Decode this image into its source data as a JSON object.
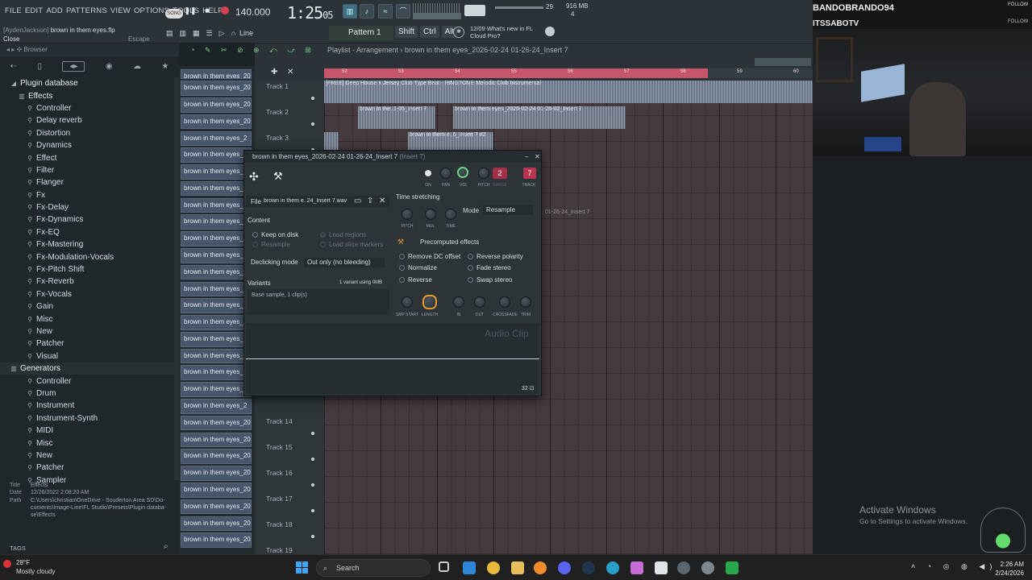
{
  "menu": [
    "FILE",
    "EDIT",
    "ADD",
    "PATTERNS",
    "VIEW",
    "OPTIONS",
    "TOOLS",
    "HELP"
  ],
  "hint": {
    "user": "[AydenJackson]",
    "file": "brown in them eyes.flp",
    "action": "Close",
    "key": "Escape"
  },
  "transport": {
    "song_label": "SONG",
    "tempo": "140.000",
    "time_main": "1:25",
    "time_sub": "05",
    "cpu": "29",
    "mem_mb": "916 MB",
    "polyphony": "4",
    "line_mode": "Line"
  },
  "pattern": {
    "name": "Pattern 1"
  },
  "modkeys": [
    "Shift",
    "Ctrl",
    "Alt"
  ],
  "news": {
    "date": "12/09",
    "text_line1": "What's new in FL",
    "text_line2": "Cloud Pro?"
  },
  "browser": {
    "title": "Browser",
    "root": "Plugin database",
    "effects": "Effects",
    "effect_items": [
      "Controller",
      "Delay reverb",
      "Distortion",
      "Dynamics",
      "Effect",
      "Filter",
      "Flanger",
      "Fx",
      "Fx-Delay",
      "Fx-Dynamics",
      "Fx-EQ",
      "Fx-Mastering",
      "Fx-Modulation-Vocals",
      "Fx-Pitch Shift",
      "Fx-Reverb",
      "Fx-Vocals",
      "Gain",
      "Misc",
      "New",
      "Patcher",
      "Visual"
    ],
    "generators": "Generators",
    "generator_items": [
      "Controller",
      "Drum",
      "Instrument",
      "Instrument-Synth",
      "MIDI",
      "Misc",
      "New",
      "Patcher",
      "Sampler"
    ],
    "info_title_label": "Title",
    "info_title": "Effects",
    "info_date_label": "Date",
    "info_date": "12/26/2022 2:08:20 AM",
    "info_path_label": "Path",
    "info_path": [
      "C:\\Users\\christian\\OneDrive - Souderton Area SD\\Do-",
      "cuments\\Image-Line\\FL Studio\\Presets\\Plugin databa-",
      "se\\Effects"
    ],
    "tags": "TAGS"
  },
  "channel_clips": [
    "brown in them eyes_202...",
    "brown in them eyes_202...",
    "brown in them eyes_202...",
    "brown in them eyes_202...",
    "brown in them eyes_2",
    "brown in them eyes_2",
    "brown in them eyes_2",
    "brown in them eyes_2",
    "brown in them eyes_2",
    "brown in them eyes_2",
    "brown in them eyes_2",
    "brown in them eyes_2",
    "brown in them eyes_2",
    "brown in them eyes_2",
    "brown in them eyes_2",
    "brown in them eyes_2",
    "brown in them eyes_2",
    "brown in them eyes_2",
    "brown in them eyes_2",
    "brown in them eyes_2",
    "brown in them eyes_2",
    "brown in them eyes_202...",
    "brown in them eyes_202...",
    "brown in them eyes_202...",
    "brown in them eyes_202...",
    "brown in them eyes_202...",
    "brown in them eyes_202...",
    "brown in them eyes_202...",
    "brown in them eyes_202..."
  ],
  "playlist": {
    "title": "Playlist - Arrangement",
    "clip_name": "brown in them eyes_2026-02-24 01-26-24_Insert 7",
    "ruler": [
      "52",
      "53",
      "54",
      "55",
      "56",
      "57",
      "58",
      "59",
      "60"
    ],
    "tracks_top": [
      "Track 1",
      "Track 2",
      "Track 3"
    ],
    "tracks_bottom": [
      "Track 14",
      "Track 15",
      "Track 16",
      "Track 17",
      "Track 18",
      "Track 19"
    ],
    "clip1": "[FREE] Deep House x Jersey Club Type Beat - RINGTONE  Melodic Club Instrumental",
    "clip2a": "brown in the..1-05_Insert 7",
    "clip2b": "brown in them eyes_2026-02-24 01-26-02_Insert 7",
    "clip3": "brown in them e..6_Insert 7 #2",
    "ghost": "01-26-24_Insert 7"
  },
  "audio_clip": {
    "title": "brown in them eyes_2026-02-24 01-26-24_Insert 7",
    "subtitle": "(Insert 7)",
    "file_label": "File",
    "file_name": "brown in them e..24_Insert 7.wav",
    "knobs_top": [
      "ON",
      "PAN",
      "VOL",
      "PITCH",
      "RANGE",
      "TRACK"
    ],
    "range_val": "2",
    "track_val": "7",
    "content": "Content",
    "keep_on_disk": "Keep on disk",
    "resample": "Resample",
    "load_regions": "Load regions",
    "load_slice": "Load slice markers",
    "declicking_label": "Declicking mode",
    "declicking_value": "Out only (no bleeding)",
    "variants": "Variants",
    "variants_info": "1 variant using 0MB",
    "base_sample": "Base sample, 1 clip(s)",
    "time_stretching": "Time stretching",
    "ts_knobs": [
      "PITCH",
      "MUL",
      "TIME"
    ],
    "mode_label": "Mode",
    "mode_value": "Resample",
    "precomputed": "Precomputed effects",
    "fx_left": [
      "Remove DC offset",
      "Normalize",
      "Reverse"
    ],
    "fx_right": [
      "Reverse polarity",
      "Fade stereo",
      "Swap stereo"
    ],
    "bottom_knobs": [
      "SMP START",
      "LENGTH",
      "IN",
      "OUT",
      "CROSSFADE",
      "TRIM"
    ],
    "watermark": "Audio Clip",
    "zoom": "32"
  },
  "stream": {
    "name1": "BANDOBRANDO94",
    "name2": "ITSSABOTV",
    "follow": "FOLLOW"
  },
  "activate": {
    "title": "Activate Windows",
    "sub": "Go to Settings to activate Windows."
  },
  "weather": {
    "temp": "28°F",
    "desc": "Mostly cloudy"
  },
  "taskbar": {
    "search": "Search",
    "time": "2:26 AM",
    "date": "2/24/2026"
  },
  "colors": {
    "ruler": "#c8566b",
    "accent_green": "#6fd38a",
    "knob_orange": "#e09a2e"
  }
}
